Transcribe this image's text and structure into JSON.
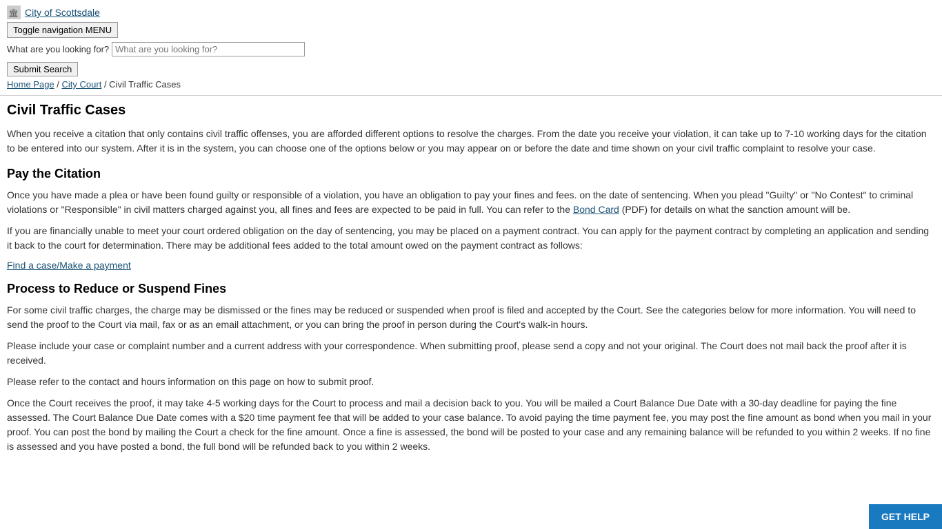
{
  "header": {
    "logo_alt": "City of Scottsdale - Home",
    "site_title": "City of Scottsdale",
    "nav_toggle_label": "Toggle navigation MENU",
    "search_label": "What are you looking for?",
    "search_placeholder": "What are you looking for?",
    "submit_search_label": "Submit Search"
  },
  "breadcrumb": {
    "home": "Home Page",
    "court": "City Court",
    "current": "Civil Traffic Cases",
    "separator": " / "
  },
  "page": {
    "title": "Civil Traffic Cases",
    "intro_para": "When you receive a citation that only contains civil traffic offenses, you are afforded different options to resolve the charges.  From the date you receive your violation, it can take up to 7-10 working days for the citation to be entered into our system.  After it is in the system, you can choose one of the options below or you may appear on or before the date and time shown on your civil traffic complaint to resolve your case.",
    "section1_heading": "Pay the Citation",
    "section1_para1": "Once you have made a plea or have been found guilty or responsible of a violation, you have an obligation to pay your fines and fees. on the date of sentencing. When you plead \"Guilty\" or \"No Contest\" to criminal violations or \"Responsible\" in civil matters charged against you, all fines and fees are expected to be paid in full. You can refer to the",
    "bond_card_link": "Bond Card",
    "section1_para1_suffix": " (PDF) for details on what the sanction amount will be.",
    "section1_para2": "If you are financially unable to meet your court ordered obligation on the day of sentencing, you may be placed on a payment contract.  You can apply for the payment contract by completing an application and sending it back to the court for determination.  There may be additional fees added to the total amount owed on the payment contract as follows:",
    "find_case_link": "Find a case/Make a payment",
    "section2_heading": "Process to Reduce or Suspend Fines",
    "section2_para1": "For some civil traffic charges, the charge may be dismissed or the fines may be reduced or suspended when proof is filed and accepted by the Court. See the categories below for more information.  You will need to send the proof to the Court via mail, fax or as an email attachment, or you can bring the proof in person during the Court's walk-in hours.",
    "section2_para2": "Please include your case or complaint number and a current address with your correspondence.  When submitting proof, please send a copy and not your original. The Court does not mail back the proof after it is received.",
    "section2_para3": "Please refer to the contact and hours information on this page on how to submit proof.",
    "section2_para4": "Once the Court receives the proof, it may take 4-5 working days for the Court to process and mail a decision back to you. You will be mailed a Court Balance Due Date with a 30-day deadline for paying the fine assessed. The Court Balance Due Date comes with a $20 time payment fee that will be added to your case balance. To avoid paying the time payment fee, you may post the fine amount as bond when you mail in your proof. You can post the bond by mailing the Court a check for the fine amount. Once a fine is assessed, the bond will be posted to your case and any remaining balance will be refunded to you within 2 weeks. If no fine is assessed and you have posted a bond, the full bond will be refunded back to you within 2 weeks.",
    "get_help_label": "GET HELP"
  },
  "colors": {
    "link": "#1a5276",
    "get_help_bg": "#1a7abf",
    "heading": "#000000"
  }
}
